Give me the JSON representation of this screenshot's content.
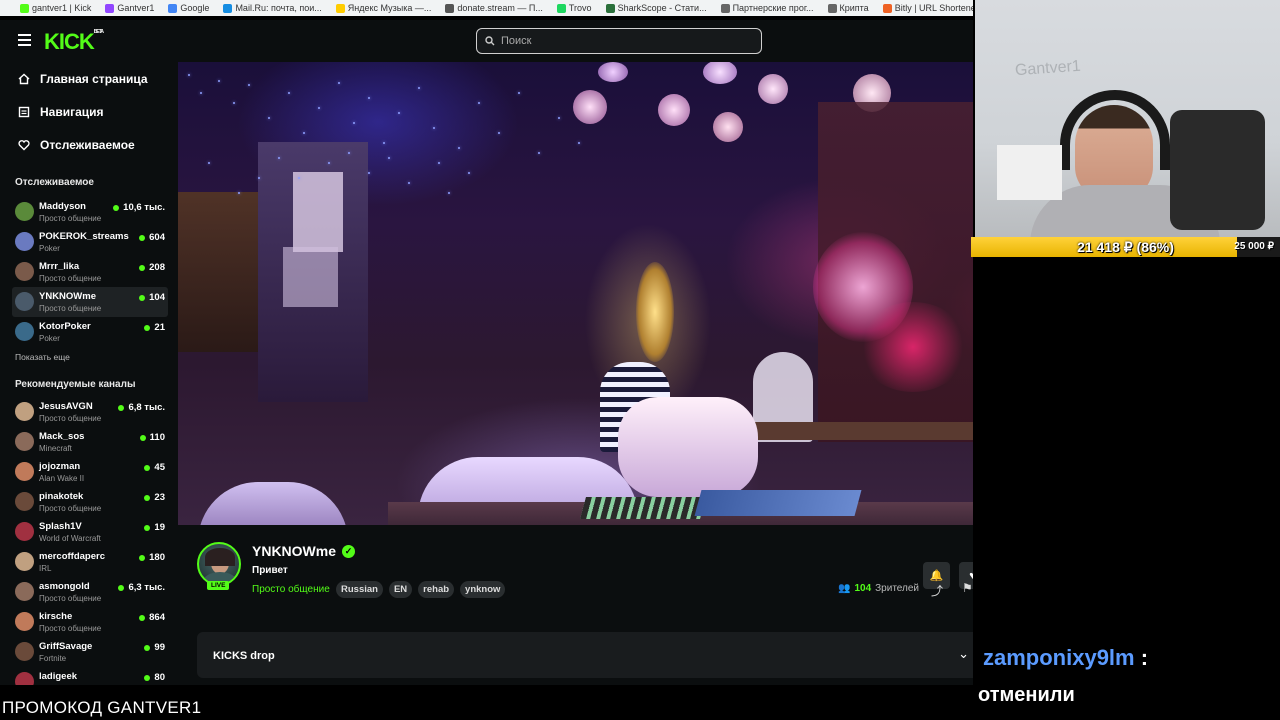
{
  "browser": {
    "bookmarks": [
      {
        "label": "gantver1 | Kick",
        "icon": "kick-icon",
        "color": "#53fc18"
      },
      {
        "label": "Gantver1",
        "icon": "twitch-icon",
        "color": "#9146ff"
      },
      {
        "label": "Google",
        "icon": "google-icon",
        "color": "#4285f4"
      },
      {
        "label": "Mail.Ru: почта, пои...",
        "icon": "mailru-icon",
        "color": "#168de2"
      },
      {
        "label": "Яндекс Музыка —...",
        "icon": "yandex-music-icon",
        "color": "#ffcc00"
      },
      {
        "label": "donate.stream — П...",
        "icon": "donate-icon",
        "color": "#555555"
      },
      {
        "label": "Trovo",
        "icon": "trovo-icon",
        "color": "#1ed760"
      },
      {
        "label": "SharkScope - Стати...",
        "icon": "sharkscope-icon",
        "color": "#2a6f3a"
      },
      {
        "label": "Партнерские прог...",
        "icon": "folder-icon",
        "color": "#666666"
      },
      {
        "label": "Крипта",
        "icon": "folder-icon",
        "color": "#666666"
      },
      {
        "label": "Bitly | URL Shortene...",
        "icon": "bitly-icon",
        "color": "#ee6123"
      }
    ]
  },
  "app": {
    "logo": "KICK",
    "logo_badge": "BETA",
    "search_placeholder": "Поиск",
    "accent": "#53fc18"
  },
  "nav": {
    "home": "Главная страница",
    "browse": "Навигация",
    "following": "Отслеживаемое"
  },
  "following": {
    "title": "Отслеживаемое",
    "show_more": "Показать еще",
    "channels": [
      {
        "name": "Maddyson",
        "category": "Просто общение",
        "viewers": "10,6 тыс."
      },
      {
        "name": "POKEROK_streams",
        "category": "Poker",
        "viewers": "604"
      },
      {
        "name": "Mrrr_lika",
        "category": "Просто общение",
        "viewers": "208"
      },
      {
        "name": "YNKNOWme",
        "category": "Просто общение",
        "viewers": "104"
      },
      {
        "name": "KotorPoker",
        "category": "Poker",
        "viewers": "21"
      }
    ]
  },
  "recommended": {
    "title": "Рекомендуемые каналы",
    "channels": [
      {
        "name": "JesusAVGN",
        "category": "Просто общение",
        "viewers": "6,8 тыс."
      },
      {
        "name": "Mack_sos",
        "category": "Minecraft",
        "viewers": "110"
      },
      {
        "name": "jojozman",
        "category": "Alan Wake II",
        "viewers": "45"
      },
      {
        "name": "pinakotek",
        "category": "Просто общение",
        "viewers": "23"
      },
      {
        "name": "Splash1V",
        "category": "World of Warcraft",
        "viewers": "19"
      },
      {
        "name": "mercoffdaperc",
        "category": "IRL",
        "viewers": "180"
      },
      {
        "name": "asmongold",
        "category": "Просто общение",
        "viewers": "6,3 тыс."
      },
      {
        "name": "kirsche",
        "category": "Просто общение",
        "viewers": "864"
      },
      {
        "name": "GriffSavage",
        "category": "Fortnite",
        "viewers": "99"
      },
      {
        "name": "ladigeek",
        "category": "",
        "viewers": "80"
      }
    ]
  },
  "stream": {
    "live_badge": "LIVE",
    "channel": "YNKNOWme",
    "title": "Привет",
    "category": "Просто общение",
    "tags": [
      "Russian",
      "EN",
      "rehab",
      "ynknow"
    ],
    "viewers_count": "104",
    "viewers_label": "Зрителей",
    "drops_label": "KICKS drop"
  },
  "overlay": {
    "donation_amount": "21 418 ₽ (86%)",
    "donation_goal": "25 000 ₽",
    "donation_progress": 0.86,
    "webcam_wall_text": "Gantver1",
    "chat_user": "zamponixy9lm",
    "chat_colon": ":",
    "chat_message": "отменили",
    "promo": "ПРОМОКОД GANTVER1"
  }
}
